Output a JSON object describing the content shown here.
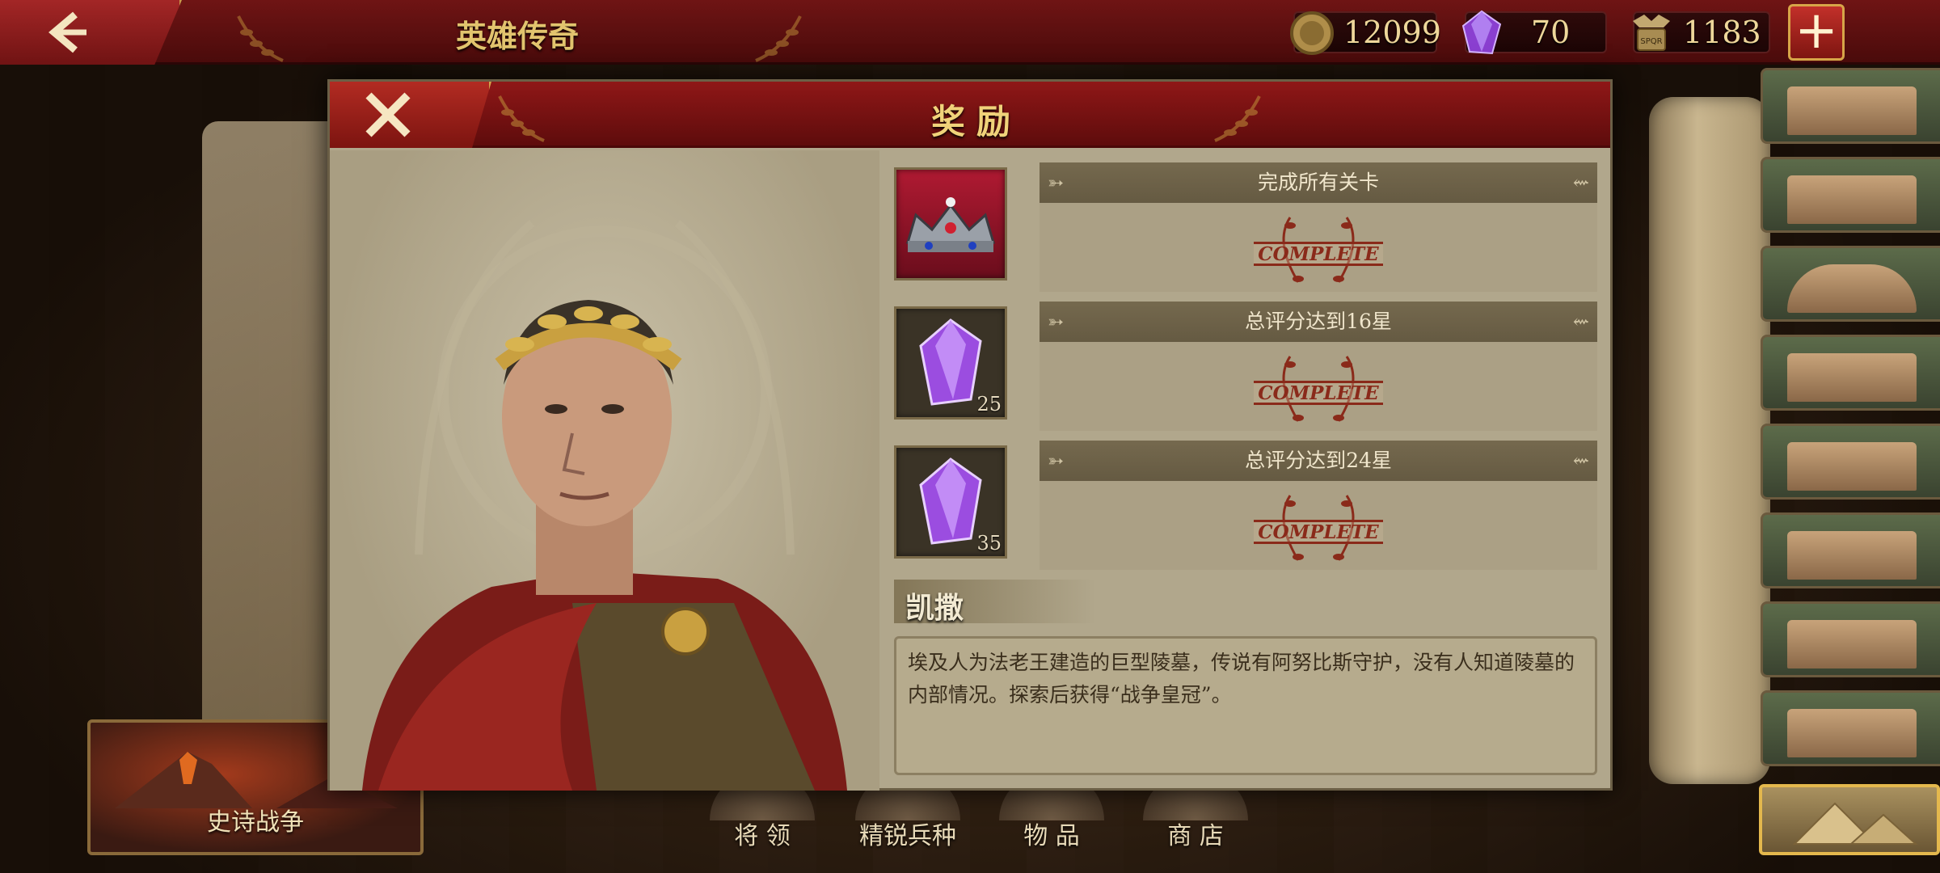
{
  "top_bar": {
    "title": "英雄传奇",
    "resources": [
      {
        "name": "gold",
        "value": "12099",
        "icon": "coin-icon"
      },
      {
        "name": "gem",
        "value": "70",
        "icon": "gem-icon"
      },
      {
        "name": "honor",
        "value": "1183",
        "icon": "spqr-eagle-icon"
      }
    ],
    "plus_label": "+"
  },
  "dialog": {
    "title": "奖励",
    "rewards": [
      {
        "condition": "完成所有关卡",
        "item": "crown",
        "quantity": "",
        "status": "COMPLETE"
      },
      {
        "condition": "总评分达到16星",
        "item": "gem",
        "quantity": "25",
        "status": "COMPLETE"
      },
      {
        "condition": "总评分达到24星",
        "item": "gem",
        "quantity": "35",
        "status": "COMPLETE"
      }
    ],
    "hero_name": "凯撒",
    "description": "埃及人为法老王建造的巨型陵墓，传说有阿努比斯守护，没有人知道陵墓的内部情况。探索后获得“战争皇冠”。"
  },
  "bottom_bar": {
    "epic_war": "史诗战争",
    "nav": [
      "将 领",
      "精锐兵种",
      "物 品",
      "商 店"
    ]
  },
  "colors": {
    "header_red": "#8f1717",
    "gold_text": "#f0d27a",
    "parchment": "#b1a78c",
    "stamp_red": "#8a2a1a",
    "gem_purple": "#9b4de0"
  }
}
